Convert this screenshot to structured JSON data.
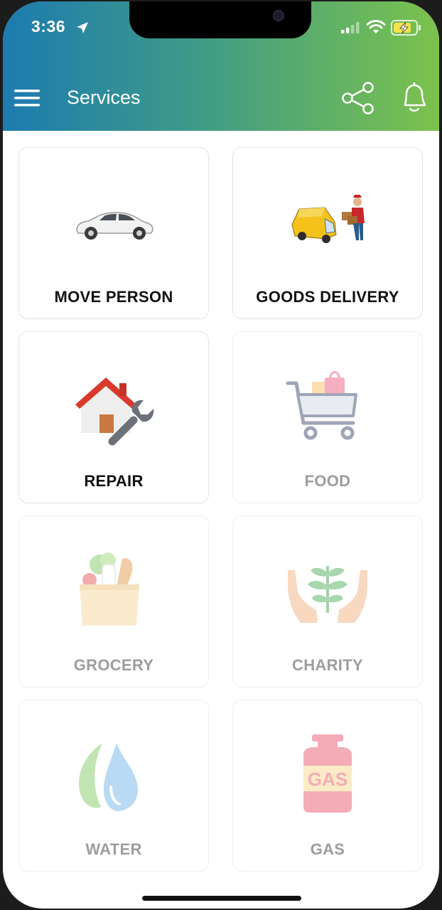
{
  "status_bar": {
    "time": "3:36"
  },
  "app_bar": {
    "title": "Services"
  },
  "services": [
    {
      "label": "MOVE PERSON",
      "icon": "car-icon",
      "enabled": true
    },
    {
      "label": "GOODS DELIVERY",
      "icon": "delivery-van-icon",
      "enabled": true
    },
    {
      "label": "REPAIR",
      "icon": "house-wrench-icon",
      "enabled": true
    },
    {
      "label": "FOOD",
      "icon": "shopping-cart-icon",
      "enabled": false
    },
    {
      "label": "GROCERY",
      "icon": "grocery-bag-icon",
      "enabled": false
    },
    {
      "label": "CHARITY",
      "icon": "hands-plant-icon",
      "enabled": false
    },
    {
      "label": "WATER",
      "icon": "water-drop-icon",
      "enabled": false
    },
    {
      "label": "GAS",
      "icon": "gas-cylinder-icon",
      "enabled": false
    }
  ],
  "colors": {
    "header_start": "#1d7bb0",
    "header_end": "#7cc24c",
    "enabled_label": "#111111",
    "disabled_label": "#9d9d9d"
  }
}
